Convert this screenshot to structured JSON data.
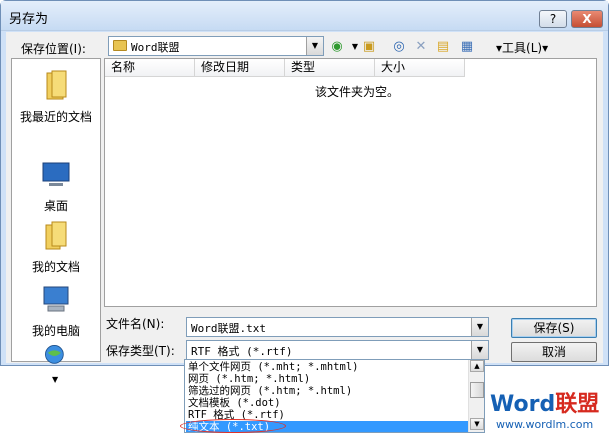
{
  "window": {
    "title": "另存为",
    "help_label": "?",
    "close_label": "X"
  },
  "toolbar": {
    "save_in_label": "保存位置(I):",
    "folder": "Word联盟",
    "tools_label": "▾工具(L)▾",
    "icons": [
      "back-icon",
      "up-folder-icon",
      "search-web-icon",
      "delete-icon",
      "new-folder-icon",
      "views-icon"
    ]
  },
  "places": [
    {
      "label": "我最近的文档",
      "icon": "recent-documents-icon"
    },
    {
      "label": "桌面",
      "icon": "desktop-icon"
    },
    {
      "label": "我的文档",
      "icon": "my-documents-icon"
    },
    {
      "label": "我的电脑",
      "icon": "my-computer-icon"
    },
    {
      "label": "",
      "icon": "network-places-icon"
    }
  ],
  "filelist": {
    "columns": [
      "名称",
      "修改日期",
      "类型",
      "大小"
    ],
    "empty_message": "该文件夹为空。"
  },
  "filename": {
    "label": "文件名(N):",
    "value": "Word联盟.txt"
  },
  "filetype": {
    "label": "保存类型(T):",
    "value": "RTF 格式 (*.rtf)",
    "options": [
      "单个文件网页 (*.mht; *.mhtml)",
      "网页 (*.htm; *.html)",
      "筛选过的网页 (*.htm; *.html)",
      "文档模板 (*.dot)",
      "RTF 格式 (*.rtf)",
      "纯文本 (*.txt)"
    ],
    "selected_index": 5
  },
  "buttons": {
    "save": "保存(S)",
    "cancel": "取消"
  },
  "watermark": {
    "logo_a": "Word",
    "logo_b": "联盟",
    "url": "www.wordlm.com"
  },
  "colors": {
    "selection": "#3399ff",
    "title_bar": "#cfe1f7",
    "highlight_ring": "#e0322a"
  }
}
